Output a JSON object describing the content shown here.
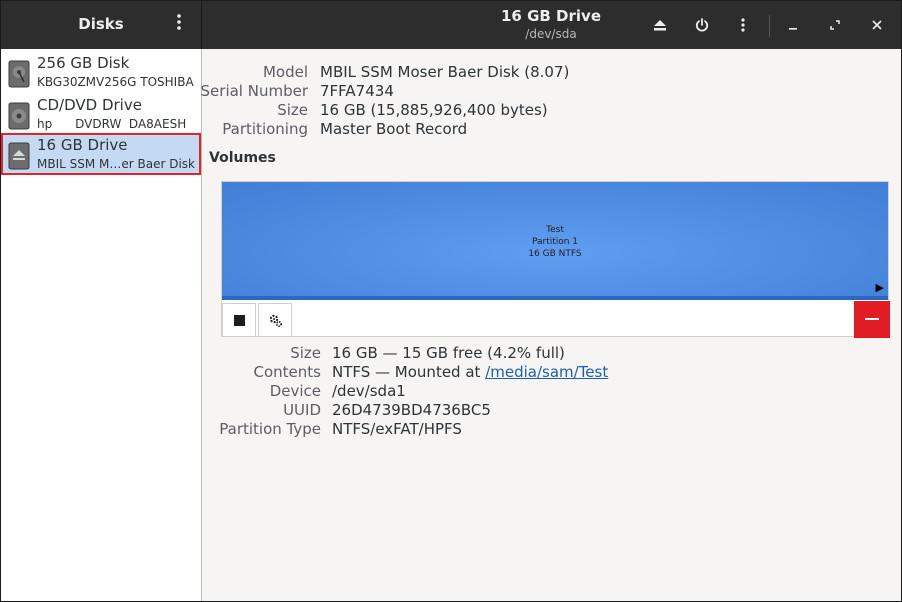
{
  "sidebar": {
    "title": "Disks",
    "menu_icon": "vertical-dots-icon",
    "items": [
      {
        "name": "256 GB Disk",
        "sub": "KBG30ZMV256G TOSHIBA",
        "icon": "hard-disk-icon"
      },
      {
        "name": "CD/DVD Drive",
        "sub": "hp      DVDRW  DA8AESH",
        "icon": "optical-drive-icon"
      },
      {
        "name": "16 GB Drive",
        "sub": "MBIL SSM M…er Baer Disk",
        "icon": "usb-drive-icon",
        "selected": true
      }
    ]
  },
  "header": {
    "title": "16 GB Drive",
    "subtitle": "/dev/sda",
    "buttons": [
      "eject-icon",
      "power-icon",
      "vertical-dots-icon",
      "minimize-icon",
      "maximize-icon",
      "close-icon"
    ]
  },
  "drive_info": {
    "model_label": "Model",
    "model": "MBIL SSM Moser Baer Disk (8.07)",
    "serial_label": "Serial Number",
    "serial": "7FFA7434",
    "size_label": "Size",
    "size": "16 GB (15,885,926,400 bytes)",
    "partitioning_label": "Partitioning",
    "partitioning": "Master Boot Record"
  },
  "volumes": {
    "title": "Volumes",
    "partition": {
      "line1": "Test",
      "line2": "Partition 1",
      "line3": "16 GB NTFS"
    },
    "toolbar": [
      "stop-icon",
      "gears-icon",
      "minus-icon"
    ]
  },
  "partition_info": {
    "size_label": "Size",
    "size": "16 GB — 15 GB free (4.2% full)",
    "contents_label": "Contents",
    "contents_prefix": "NTFS — Mounted at ",
    "contents_link": "/media/sam/Test",
    "device_label": "Device",
    "device": "/dev/sda1",
    "uuid_label": "UUID",
    "uuid": "26D4739BD4736BC5",
    "type_label": "Partition Type",
    "type": "NTFS/exFAT/HPFS"
  },
  "colors": {
    "headerbar": "#2d2d2d",
    "selection": "#c4daf3",
    "selection_outline": "#e0242f",
    "volume": "#4d8ae0",
    "destructive": "#e01b24",
    "link": "#1a5fb4"
  }
}
